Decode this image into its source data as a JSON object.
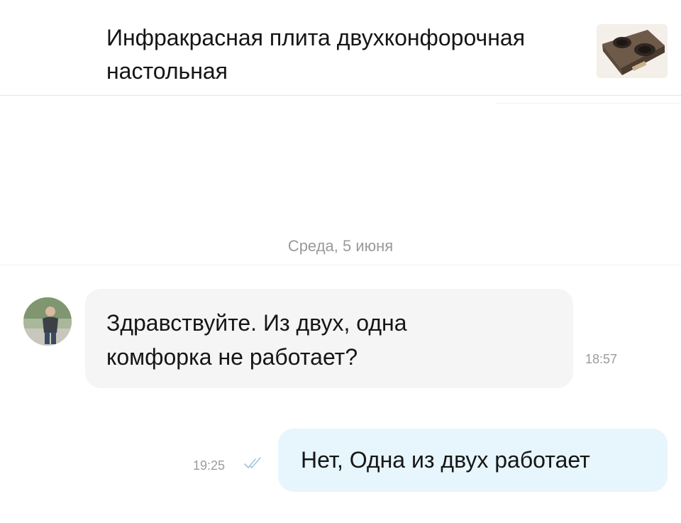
{
  "header": {
    "title": "Инфракрасная плита двухконфорочная настольная",
    "thumbnail_icon": "stove-product-thumbnail"
  },
  "chat": {
    "date_divider": "Среда, 5 июня",
    "messages": [
      {
        "direction": "incoming",
        "text": "Здравствуйте. Из двух, одна комфорка не работает?",
        "time": "18:57",
        "avatar_icon": "user-avatar"
      },
      {
        "direction": "outgoing",
        "text": "Нет, Одна из двух работает",
        "time": "19:25",
        "status_icon": "double-check-icon"
      }
    ]
  },
  "colors": {
    "incoming_bubble": "#f5f5f5",
    "outgoing_bubble": "#e7f5fd",
    "timestamp": "#9b9b9b",
    "read_check": "#9fc7d9"
  }
}
